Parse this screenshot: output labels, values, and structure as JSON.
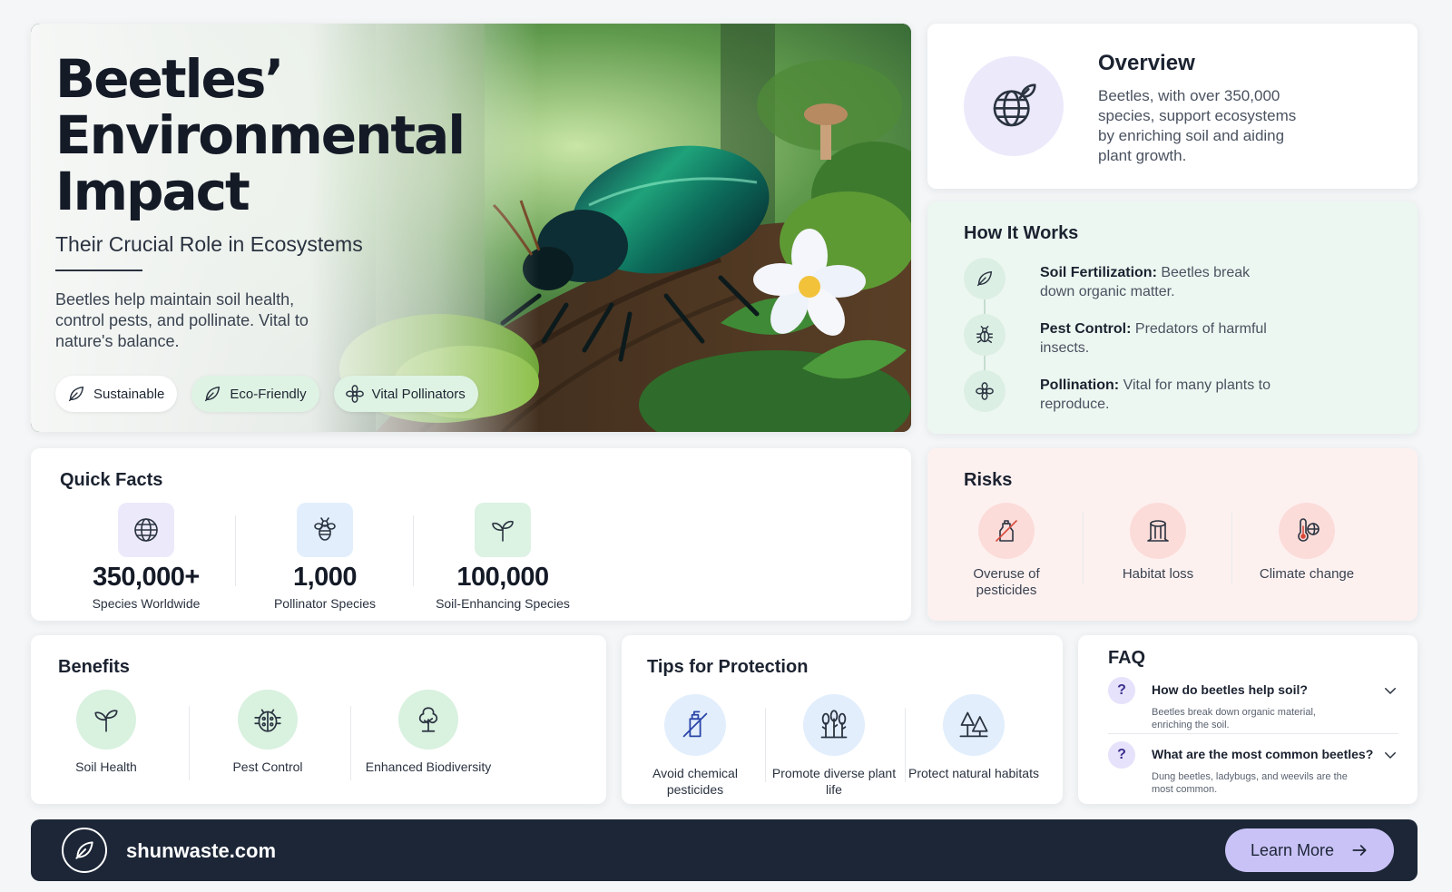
{
  "hero": {
    "title_line1": "Beetles’",
    "title_line2": "Environmental",
    "title_line3": "Impact",
    "subtitle": "Their Crucial Role in Ecosystems",
    "description": "Beetles help maintain soil health, control pests, and pollinate. Vital to nature's balance.",
    "tags": [
      {
        "label": "Sustainable",
        "icon": "leaf-icon"
      },
      {
        "label": "Eco-Friendly",
        "icon": "leaf-icon"
      },
      {
        "label": "Vital Pollinators",
        "icon": "flower-icon"
      }
    ]
  },
  "overview": {
    "title": "Overview",
    "text": "Beetles, with over 350,000 species, support ecosystems by enriching soil and aiding plant growth.",
    "icon": "globe-leaf-icon"
  },
  "how_it_works": {
    "title": "How It Works",
    "steps": [
      {
        "term": "Soil Fertilization:",
        "text": "Beetles break down organic matter.",
        "icon": "leaf-icon"
      },
      {
        "term": "Pest Control:",
        "text": "Predators of harmful insects.",
        "icon": "bug-icon"
      },
      {
        "term": "Pollination:",
        "text": "Vital for many plants to reproduce.",
        "icon": "flower-icon"
      }
    ]
  },
  "quick_facts": {
    "title": "Quick Facts",
    "items": [
      {
        "value": "350,000+",
        "label": "Species Worldwide",
        "icon": "globe-icon",
        "color": "#ece9fb"
      },
      {
        "value": "1,000",
        "label": "Pollinator Species",
        "icon": "bee-icon",
        "color": "#e2eefc"
      },
      {
        "value": "100,000",
        "label": "Soil-Enhancing Species",
        "icon": "sprout-icon",
        "color": "#dcf2e3"
      }
    ]
  },
  "risks": {
    "title": "Risks",
    "items": [
      {
        "label": "Overuse of pesticides",
        "icon": "no-pesticide-icon"
      },
      {
        "label": "Habitat loss",
        "icon": "tree-stump-icon"
      },
      {
        "label": "Climate change",
        "icon": "thermometer-globe-icon"
      }
    ]
  },
  "benefits": {
    "title": "Benefits",
    "items": [
      {
        "label": "Soil Health",
        "icon": "sprout-icon"
      },
      {
        "label": "Pest Control",
        "icon": "ladybug-icon"
      },
      {
        "label": "Enhanced Biodiversity",
        "icon": "tree-icon"
      }
    ]
  },
  "tips": {
    "title": "Tips for Protection",
    "items": [
      {
        "label": "Avoid chemical pesticides",
        "icon": "no-spray-icon"
      },
      {
        "label": "Promote diverse plant life",
        "icon": "plants-icon"
      },
      {
        "label": "Protect natural habitats",
        "icon": "trees-icon"
      }
    ]
  },
  "faq": {
    "title": "FAQ",
    "items": [
      {
        "question": "How do beetles help soil?",
        "answer": "Beetles break down organic material, enriching the soil."
      },
      {
        "question": "What are the most common beetles?",
        "answer": "Dung beetles, ladybugs, and weevils are the most common."
      }
    ]
  },
  "footer": {
    "site": "shunwaste.com",
    "cta": "Learn More"
  },
  "colors": {
    "footer_bg": "#1c2637",
    "cta_bg": "#c9c2f6",
    "green_tint": "#edf7f1",
    "risk_tint": "#fdf1f0",
    "lavender": "#ece9fb"
  }
}
